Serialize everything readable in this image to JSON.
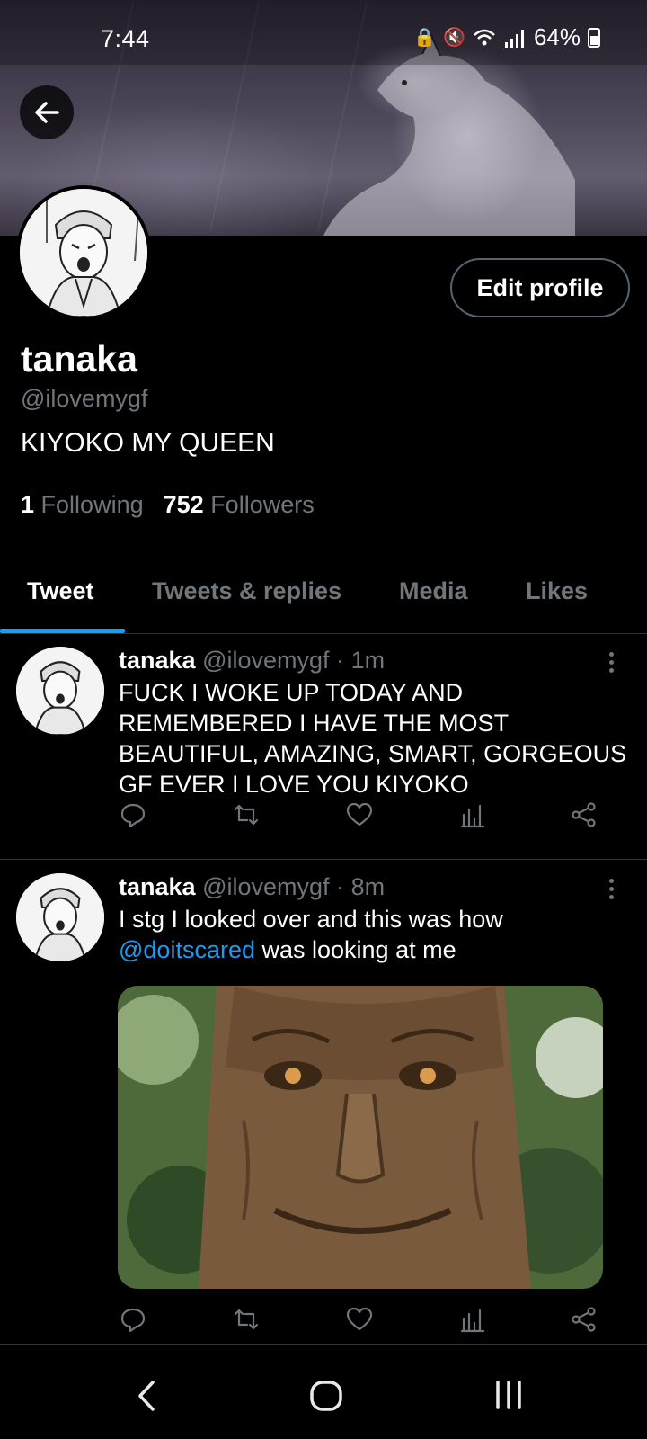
{
  "status_bar": {
    "time": "7:44",
    "battery": "64%"
  },
  "profile": {
    "display_name": "tanaka",
    "handle": "@ilovemygf",
    "bio": "KIYOKO MY QUEEN",
    "following_count": "1",
    "following_label": "Following",
    "followers_count": "752",
    "followers_label": "Followers",
    "edit_profile_label": "Edit profile"
  },
  "tabs": [
    {
      "label": "Tweet",
      "active": true
    },
    {
      "label": "Tweets & replies",
      "active": false
    },
    {
      "label": "Media",
      "active": false
    },
    {
      "label": "Likes",
      "active": false
    }
  ],
  "tweets": [
    {
      "name": "tanaka",
      "handle": "@ilovemygf",
      "sep": "·",
      "time": "1m",
      "text": "FUCK I WOKE UP TODAY AND REMEMBERED I HAVE THE MOST BEAUTIFUL, AMAZING, SMART, GORGEOUS GF EVER I LOVE YOU KIYOKO"
    },
    {
      "name": "tanaka",
      "handle": "@ilovemygf",
      "sep": "·",
      "time": "8m",
      "text_before": "I stg I looked over and this was how ",
      "mention": "@doitscared",
      "text_after": " was looking at me",
      "has_image": true
    }
  ],
  "icons": {
    "back": "arrow-left-icon",
    "reply": "reply-icon",
    "retweet": "retweet-icon",
    "like": "heart-icon",
    "views": "views-icon",
    "share": "share-icon",
    "more": "more-icon"
  },
  "colors": {
    "accent": "#1d9bf0",
    "muted": "#71767b",
    "background": "#000000"
  }
}
